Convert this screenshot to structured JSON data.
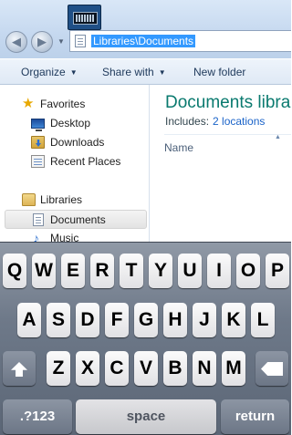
{
  "explorer": {
    "address_path": "Libraries\\Documents",
    "toolbar": {
      "organize": "Organize",
      "share_with": "Share with",
      "new_folder": "New folder"
    },
    "nav": {
      "favorites": "Favorites",
      "desktop": "Desktop",
      "downloads": "Downloads",
      "recent_places": "Recent Places",
      "libraries": "Libraries",
      "documents": "Documents",
      "music": "Music"
    },
    "main": {
      "title": "Documents libra",
      "includes_label": "Includes:",
      "includes_link": "2 locations",
      "column_name": "Name"
    }
  },
  "keyboard": {
    "row1": [
      "Q",
      "W",
      "E",
      "R",
      "T",
      "Y",
      "U",
      "I",
      "O",
      "P"
    ],
    "row2": [
      "A",
      "S",
      "D",
      "F",
      "G",
      "H",
      "J",
      "K",
      "L"
    ],
    "row3": [
      "Z",
      "X",
      "C",
      "V",
      "B",
      "N",
      "M"
    ],
    "numbers_key": ".?123",
    "space_key": "space",
    "return_key": "return"
  },
  "icons": [
    "keyboard-icon",
    "back-arrow-icon",
    "forward-arrow-icon",
    "history-dropdown-icon",
    "document-icon",
    "star-icon",
    "desktop-icon",
    "downloads-icon",
    "recent-places-icon",
    "libraries-icon",
    "music-icon",
    "shift-icon",
    "backspace-icon",
    "caret-down-icon"
  ],
  "colors": {
    "selection_highlight": "#3399ff",
    "title_text": "#0a7a6f",
    "link_text": "#1a63c8",
    "keyboard_background": "#6e7989"
  }
}
